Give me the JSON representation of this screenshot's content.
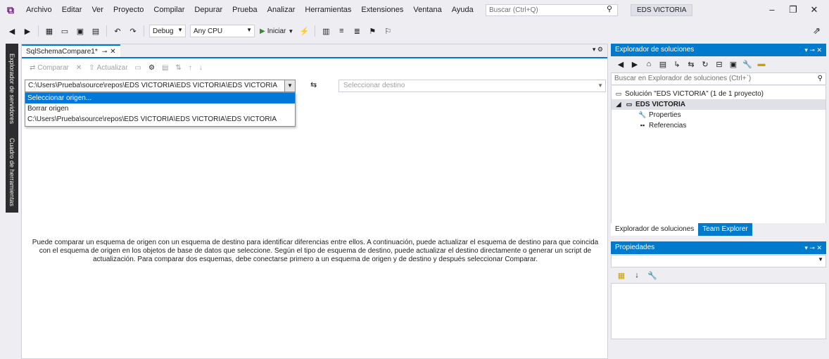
{
  "menu": {
    "items": [
      "Archivo",
      "Editar",
      "Ver",
      "Proyecto",
      "Compilar",
      "Depurar",
      "Prueba",
      "Analizar",
      "Herramientas",
      "Extensiones",
      "Ventana",
      "Ayuda"
    ],
    "search_placeholder": "Buscar (Ctrl+Q)",
    "solution_name": "EDS VICTORIA"
  },
  "toolbar": {
    "config": "Debug",
    "platform": "Any CPU",
    "start_label": "Iniciar"
  },
  "left_tabs": [
    "Explorador de servidores",
    "Cuadro de herramientas"
  ],
  "document": {
    "tab_title": "SqlSchemaCompare1*",
    "compare_toolbar": [
      "Comparar",
      "Actualizar"
    ],
    "source_value": "C:\\Users\\Prueba\\source\\repos\\EDS VICTORIA\\EDS VICTORIA\\EDS VICTORIA",
    "target_placeholder": "Seleccionar destino",
    "dropdown_items": [
      "Seleccionar origen...",
      "Borrar origen",
      "C:\\Users\\Prueba\\source\\repos\\EDS VICTORIA\\EDS VICTORIA\\EDS VICTORIA"
    ],
    "selected_index": 0,
    "info_text": "Puede comparar un esquema de origen con un esquema de destino para identificar diferencias entre ellos. A continuación, puede actualizar el esquema de destino para que coincida con el esquema de origen en los objetos de base de datos que seleccione. Según el tipo de esquema de destino, puede actualizar el destino directamente o generar un script de actualización. Para comparar dos esquemas, debe conectarse primero a un esquema de origen y de destino y después seleccionar Comparar."
  },
  "solution_explorer": {
    "title": "Explorador de soluciones",
    "search_placeholder": "Buscar en Explorador de soluciones (Ctrl+`)",
    "tree": {
      "solution": "Solución \"EDS VICTORIA\" (1 de 1 proyecto)",
      "project": "EDS VICTORIA",
      "properties": "Properties",
      "references": "Referencias"
    },
    "tabs": [
      "Explorador de soluciones",
      "Team Explorer"
    ]
  },
  "properties": {
    "title": "Propiedades"
  },
  "colors": {
    "accent": "#007acc",
    "selection": "#0078d7",
    "chrome": "#eeeef2"
  }
}
